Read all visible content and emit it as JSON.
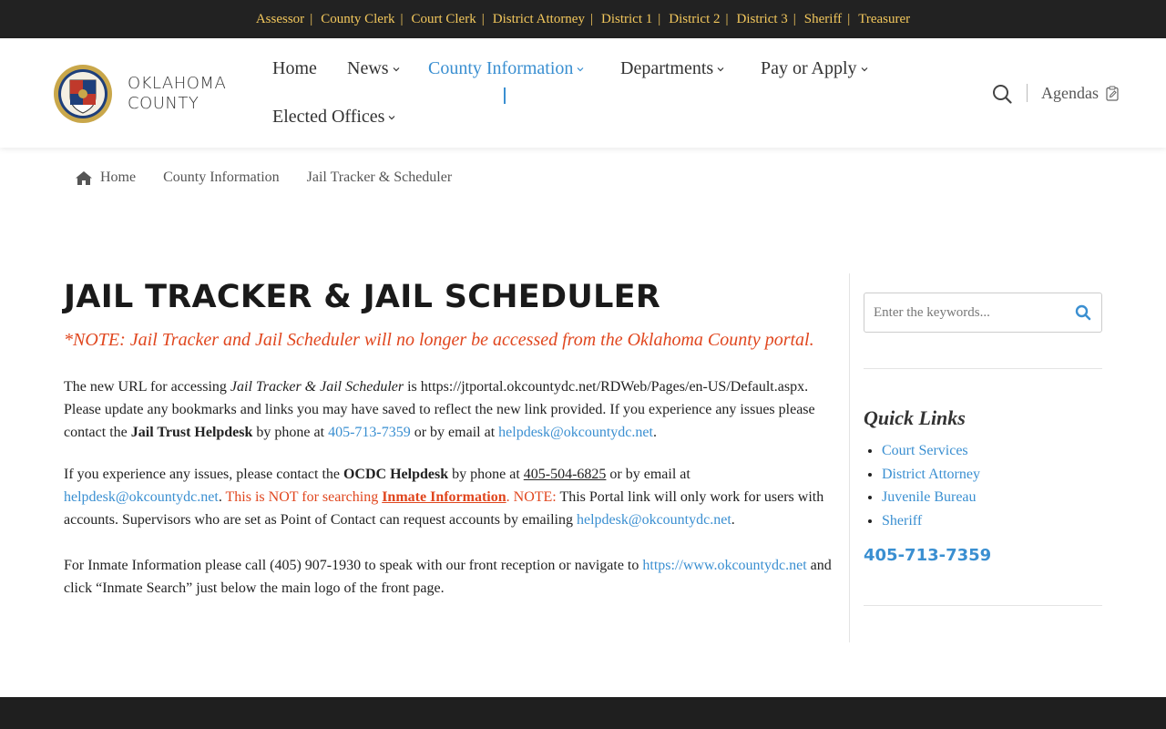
{
  "topbar": {
    "links": [
      "Assessor",
      "County Clerk",
      "Court Clerk",
      "District Attorney",
      "District 1",
      "District 2",
      "District 3",
      "Sheriff",
      "Treasurer"
    ],
    "separator": "|",
    "color": "#f2c75c"
  },
  "header": {
    "logo_line1": "OKLAHOMA",
    "logo_line2": "COUNTY",
    "nav": {
      "home": "Home",
      "news": "News",
      "county_information": "County Information",
      "departments": "Departments",
      "pay_or_apply": "Pay or Apply",
      "elected_offices": "Elected Offices"
    },
    "active_nav": "County Information",
    "agendas_label": "Agendas",
    "accent_color": "#3a8fd1"
  },
  "breadcrumb": {
    "home": "Home",
    "level1": "County Information",
    "level2": "Jail Tracker & Scheduler"
  },
  "main": {
    "title": "JAIL TRACKER & JAIL SCHEDULER",
    "note": "*NOTE: Jail Tracker and Jail Scheduler will no longer be accessed from the Oklahoma County portal.",
    "p1": {
      "t1": "The new URL for accessing ",
      "t2": "Jail Tracker & Jail Scheduler",
      "t3": " is https://jtportal.okcountydc.net/RDWeb/Pages/en-US/Default.aspx. Please update any bookmarks and links you may have saved to reflect the new link provided. If you experience any issues please contact the ",
      "t4": "Jail Trust Helpdesk",
      "t5": " by phone at ",
      "phone": "405-713-7359",
      "t6": " or by email at ",
      "email": "helpdesk@okcountydc.net",
      "t7": "."
    },
    "p2": {
      "t1": "If you experience any issues, please contact the ",
      "t2": "OCDC Helpdesk",
      "t3": " by phone at ",
      "phone": "405-504-6825",
      "t4": " or by email at ",
      "email": "helpdesk@okcountydc.net",
      "t5": ". ",
      "red1": "This is NOT for searching ",
      "red_link": "Inmate Information",
      "red2": ". NOTE:",
      "t6": " This Portal link will only work for users with accounts. Supervisors who are set as Point of Contact can request accounts by emailing ",
      "email2": "helpdesk@okcountydc.net",
      "t7": "."
    },
    "p3": {
      "t1": "For Inmate Information please call (405) 907-1930 to speak with our front reception or navigate to ",
      "link": "https://www.okcountydc.net",
      "t2": " and click “Inmate Search” just below the main logo of the front page."
    }
  },
  "sidebar": {
    "search_placeholder": "Enter the keywords...",
    "quick_links_title": "Quick Links",
    "quick_links": [
      "Court Services",
      "District Attorney",
      "Juvenile Bureau",
      "Sheriff"
    ],
    "phone": "405-713-7359"
  },
  "colors": {
    "topbar_bg": "#222222",
    "alert_red": "#e0461e",
    "link_blue": "#3a8fd1",
    "footer_bg": "#1f1f1f"
  }
}
